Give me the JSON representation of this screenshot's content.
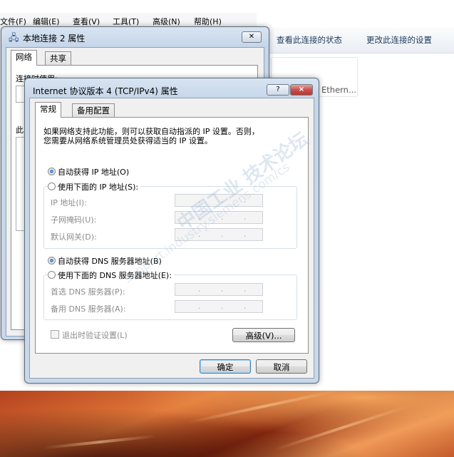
{
  "explorer": {
    "menu": [
      "文件(F)",
      "编辑(E)",
      "查看(V)",
      "工具(T)",
      "高级(N)",
      "帮助(H)"
    ],
    "commands": [
      "查看此连接的状态",
      "更改此连接的设置"
    ],
    "tile_label": "Ethern..."
  },
  "conn_dialog": {
    "title": "本地连接 2 属性",
    "tabs": [
      "网络",
      "共享"
    ],
    "partial_label": "连接时使用:",
    "partial_label2": "此"
  },
  "ipv4_dialog": {
    "title": "Internet 协议版本 4 (TCP/IPv4) 属性",
    "help_button": "?",
    "close_button": "×",
    "tabs": [
      "常规",
      "备用配置"
    ],
    "description": [
      "如果网络支持此功能，则可以获取自动指派的 IP 设置。否则，",
      "您需要从网络系统管理员处获得适当的 IP 设置。"
    ],
    "ip_auto_label": "自动获得 IP 地址(O)",
    "ip_manual_label": "使用下面的 IP 地址(S):",
    "ip_fields": [
      {
        "label": "IP 地址(I):"
      },
      {
        "label": "子网掩码(U):"
      },
      {
        "label": "默认网关(D):"
      }
    ],
    "dns_auto_label": "自动获得 DNS 服务器地址(B)",
    "dns_manual_label": "使用下面的 DNS 服务器地址(E):",
    "dns_fields": [
      {
        "label": "首选 DNS 服务器(P):"
      },
      {
        "label": "备用 DNS 服务器(A):"
      }
    ],
    "validate_label": "退出时验证设置(L)",
    "advanced_button": "高级(V)...",
    "ok_button": "确定",
    "cancel_button": "取消",
    "ip_auto_selected": true,
    "dns_auto_selected": true,
    "validate_checked": false
  },
  "watermark": {
    "text": "中国工业 技术论坛",
    "url": "support.industry.siemens.com/cs"
  },
  "colors": {
    "accent": "#3c7fb1",
    "window_frame": "#c6d6e9",
    "close_red": "#c75050"
  }
}
